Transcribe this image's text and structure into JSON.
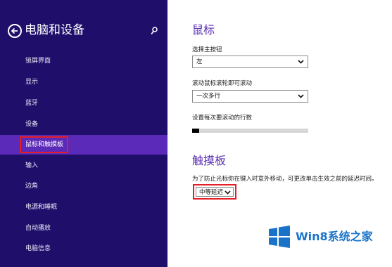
{
  "sidebar": {
    "title": "电脑和设备",
    "items": [
      {
        "label": "锁屏界面"
      },
      {
        "label": "显示"
      },
      {
        "label": "蓝牙"
      },
      {
        "label": "设备"
      },
      {
        "label": "鼠标和触摸板"
      },
      {
        "label": "输入"
      },
      {
        "label": "边角"
      },
      {
        "label": "电源和睡眠"
      },
      {
        "label": "自动播放"
      },
      {
        "label": "电脑信息"
      }
    ],
    "active_index": 4
  },
  "mouse": {
    "heading": "鼠标",
    "primary_button_label": "选择主按钮",
    "primary_button_value": "左",
    "scroll_label": "滚动鼠标滚轮即可滚动",
    "scroll_value": "一次多行",
    "lines_label": "设置每次要滚动的行数",
    "lines_slider_fraction": 0.06
  },
  "touchpad": {
    "heading": "触摸板",
    "delay_description": "为了防止光标你在键入时意外移动，可更改单击生效之前的延迟时间。",
    "delay_value": "中等延迟"
  },
  "watermark": {
    "text": "Win8系统之家"
  },
  "colors": {
    "sidebar_bg": "#1f0f6b",
    "active_item_bg": "#5c2ab8",
    "heading": "#5a2fb0",
    "highlight_red": "#e51d24",
    "watermark_blue": "#1a73c9"
  }
}
